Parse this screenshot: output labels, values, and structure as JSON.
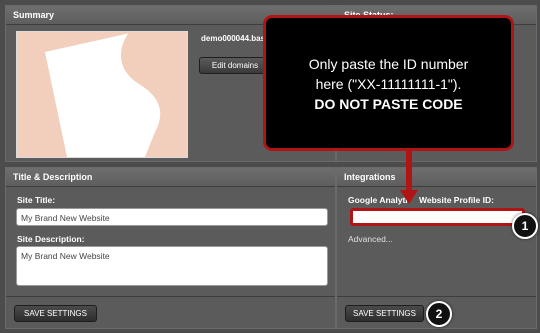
{
  "summary": {
    "header": "Summary",
    "domain_text": "demo000044.bas",
    "edit_domains_label": "Edit domains"
  },
  "site_status": {
    "header": "Site Status:"
  },
  "title_description": {
    "header": "Title & Description",
    "site_title_label": "Site Title:",
    "site_title_value": "My Brand New Website",
    "site_description_label": "Site Description:",
    "site_description_value": "My Brand New Website",
    "save_label": "SAVE SETTINGS"
  },
  "integrations": {
    "header": "Integrations",
    "ga_label_left": "Google Analyti",
    "ga_label_right": "Website Profile ID:",
    "ga_value": "",
    "advanced_label": "Advanced...",
    "save_label": "SAVE SETTINGS"
  },
  "callout": {
    "line1": "Only paste the ID number",
    "line2": "here (\"XX-11111111-1\").",
    "line3": "DO NOT PASTE CODE"
  },
  "badges": {
    "one": "1",
    "two": "2"
  },
  "colors": {
    "callout_border": "#b01515",
    "callout_bg": "#000000",
    "panel_bg": "#5b5b5b"
  },
  "icons": [
    "site-thumbnail",
    "down-arrow-icon"
  ]
}
